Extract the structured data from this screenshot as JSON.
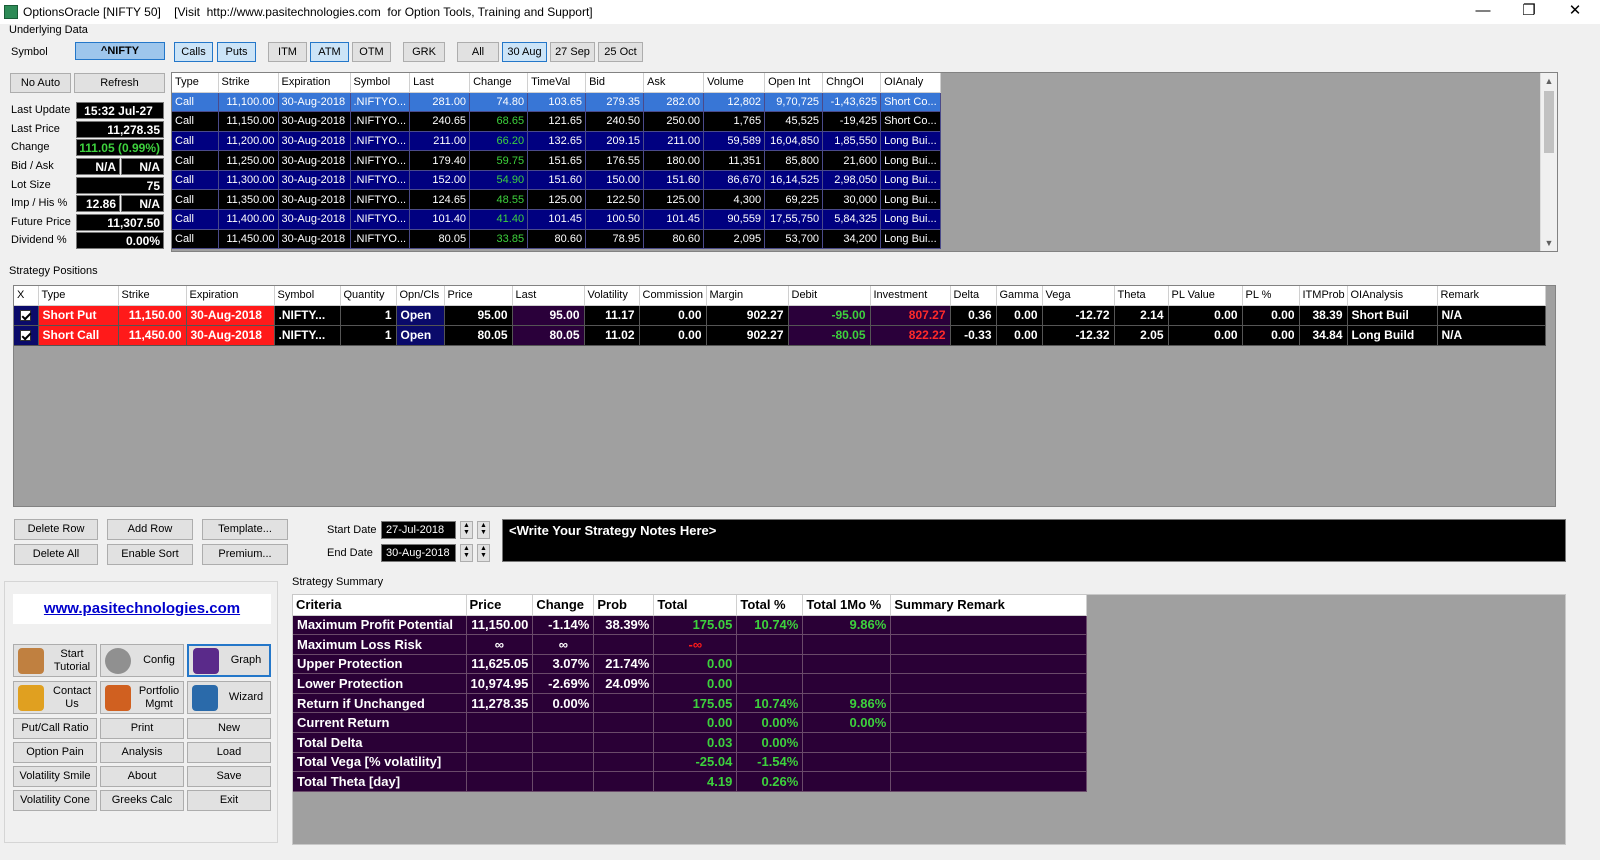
{
  "title": "OptionsOracle [NIFTY 50]    [Visit  http://www.pasitechnologies.com  for Option Tools, Training and Support]",
  "window": {
    "minimize": "—",
    "maximize": "❐",
    "close": "✕"
  },
  "underlying": {
    "group_label": "Underlying Data",
    "symbol_label": "Symbol",
    "symbol_value": "^NIFTY",
    "filters": {
      "calls": "Calls",
      "puts": "Puts",
      "itm": "ITM",
      "atm": "ATM",
      "otm": "OTM",
      "grk": "GRK",
      "all": "All",
      "exp1": "30 Aug",
      "exp2": "27 Sep",
      "exp3": "25 Oct"
    },
    "no_auto": "No Auto",
    "refresh": "Refresh",
    "fields": {
      "last_update_label": "Last Update",
      "last_update": "15:32 Jul-27",
      "last_price_label": "Last Price",
      "last_price": "11,278.35",
      "change_label": "Change",
      "change": "111.05 (0.99%)",
      "bidask_label": "Bid / Ask",
      "bid": "N/A",
      "ask": "N/A",
      "lot_label": "Lot Size",
      "lot": "75",
      "imp_label": "Imp / His %",
      "imp": "12.86",
      "his": "N/A",
      "future_label": "Future Price",
      "future": "11,307.50",
      "div_label": "Dividend %",
      "div": "0.00%"
    }
  },
  "options_table": {
    "headers": [
      "Type",
      "Strike",
      "Expiration",
      "Symbol",
      "Last",
      "Change",
      "TimeVal",
      "Bid",
      "Ask",
      "Volume",
      "Open Int",
      "ChngOI",
      "OIAnaly"
    ],
    "rows": [
      [
        "Call",
        "11,100.00",
        "30-Aug-2018",
        ".NIFTYO...",
        "281.00",
        "74.80",
        "103.65",
        "279.35",
        "282.00",
        "12,802",
        "9,70,725",
        "-1,43,625",
        "Short Co..."
      ],
      [
        "Call",
        "11,150.00",
        "30-Aug-2018",
        ".NIFTYO...",
        "240.65",
        "68.65",
        "121.65",
        "240.50",
        "250.00",
        "1,765",
        "45,525",
        "-19,425",
        "Short Co..."
      ],
      [
        "Call",
        "11,200.00",
        "30-Aug-2018",
        ".NIFTYO...",
        "211.00",
        "66.20",
        "132.65",
        "209.15",
        "211.00",
        "59,589",
        "16,04,850",
        "1,85,550",
        "Long Bui..."
      ],
      [
        "Call",
        "11,250.00",
        "30-Aug-2018",
        ".NIFTYO...",
        "179.40",
        "59.75",
        "151.65",
        "176.55",
        "180.00",
        "11,351",
        "85,800",
        "21,600",
        "Long Bui..."
      ],
      [
        "Call",
        "11,300.00",
        "30-Aug-2018",
        ".NIFTYO...",
        "152.00",
        "54.90",
        "151.60",
        "150.00",
        "151.60",
        "86,670",
        "16,14,525",
        "2,98,050",
        "Long Bui..."
      ],
      [
        "Call",
        "11,350.00",
        "30-Aug-2018",
        ".NIFTYO...",
        "124.65",
        "48.55",
        "125.00",
        "122.50",
        "125.00",
        "4,300",
        "69,225",
        "30,000",
        "Long Bui..."
      ],
      [
        "Call",
        "11,400.00",
        "30-Aug-2018",
        ".NIFTYO...",
        "101.40",
        "41.40",
        "101.45",
        "100.50",
        "101.45",
        "90,559",
        "17,55,750",
        "5,84,325",
        "Long Bui..."
      ],
      [
        "Call",
        "11,450.00",
        "30-Aug-2018",
        ".NIFTYO...",
        "80.05",
        "33.85",
        "80.60",
        "78.95",
        "80.60",
        "2,095",
        "53,700",
        "34,200",
        "Long Bui..."
      ]
    ]
  },
  "positions": {
    "group_label": "Strategy Positions",
    "headers": [
      "X",
      "Type",
      "Strike",
      "Expiration",
      "Symbol",
      "Quantity",
      "Opn/Cls",
      "Price",
      "Last",
      "Volatility",
      "Commission",
      "Margin",
      "Debit",
      "Investment",
      "Delta",
      "Gamma",
      "Vega",
      "Theta",
      "PL Value",
      "PL %",
      "ITMProb",
      "OIAnalysis",
      "Remark"
    ],
    "rows": [
      [
        "",
        "Short Put",
        "11,150.00",
        "30-Aug-2018",
        ".NIFTY...",
        "1",
        "Open",
        "95.00",
        "95.00",
        "11.17",
        "0.00",
        "902.27",
        "-95.00",
        "807.27",
        "0.36",
        "0.00",
        "-12.72",
        "2.14",
        "0.00",
        "0.00",
        "38.39",
        "Short Buil",
        "N/A"
      ],
      [
        "",
        "Short Call",
        "11,450.00",
        "30-Aug-2018",
        ".NIFTY...",
        "1",
        "Open",
        "80.05",
        "80.05",
        "11.02",
        "0.00",
        "902.27",
        "-80.05",
        "822.22",
        "-0.33",
        "0.00",
        "-12.32",
        "2.05",
        "0.00",
        "0.00",
        "34.84",
        "Long Build",
        "N/A"
      ]
    ]
  },
  "actions": {
    "delete_row": "Delete Row",
    "add_row": "Add Row",
    "template": "Template...",
    "delete_all": "Delete All",
    "enable_sort": "Enable Sort",
    "premium": "Premium...",
    "start_label": "Start Date",
    "start": "27-Jul-2018",
    "end_label": "End Date",
    "end": "30-Aug-2018",
    "notes": "<Write Your Strategy Notes Here>"
  },
  "nav": {
    "link": "www.pasitechnologies.com",
    "start_tutorial": "Start Tutorial",
    "config": "Config",
    "graph": "Graph",
    "contact": "Contact Us",
    "portfolio": "Portfolio Mgmt",
    "wizard": "Wizard",
    "putcall": "Put/Call Ratio",
    "print": "Print",
    "new": "New",
    "option_pain": "Option Pain",
    "analysis": "Analysis",
    "load": "Load",
    "vol_smile": "Volatility Smile",
    "about": "About",
    "save": "Save",
    "vol_cone": "Volatility Cone",
    "greeks": "Greeks Calc",
    "exit": "Exit"
  },
  "summary": {
    "group_label": "Strategy Summary",
    "headers": [
      "Criteria",
      "Price",
      "Change",
      "Prob",
      "Total",
      "Total %",
      "Total 1Mo %",
      "Summary Remark"
    ],
    "rows": [
      [
        "Maximum Profit Potential",
        "11,150.00",
        "-1.14%",
        "38.39%",
        "175.05",
        "10.74%",
        "9.86%",
        ""
      ],
      [
        "Maximum Loss Risk",
        "∞",
        "∞",
        "",
        "-∞",
        "",
        "",
        ""
      ],
      [
        "Upper Protection",
        "11,625.05",
        "3.07%",
        "21.74%",
        "0.00",
        "",
        "",
        ""
      ],
      [
        "Lower Protection",
        "10,974.95",
        "-2.69%",
        "24.09%",
        "0.00",
        "",
        "",
        ""
      ],
      [
        "Return if Unchanged",
        "11,278.35",
        "0.00%",
        "",
        "175.05",
        "10.74%",
        "9.86%",
        ""
      ],
      [
        "Current Return",
        "",
        "",
        "",
        "0.00",
        "0.00%",
        "0.00%",
        ""
      ],
      [
        "Total Delta",
        "",
        "",
        "",
        "0.03",
        "0.00%",
        "",
        ""
      ],
      [
        "Total Vega [% volatility]",
        "",
        "",
        "",
        "-25.04",
        "-1.54%",
        "",
        ""
      ],
      [
        "Total Theta [day]",
        "",
        "",
        "",
        "4.19",
        "0.26%",
        "",
        ""
      ]
    ]
  },
  "colors": {
    "accent": "#3876d6",
    "grid_bg": "#a0a0a0",
    "positive": "#3dd13d",
    "negative": "#ff1a1a"
  }
}
